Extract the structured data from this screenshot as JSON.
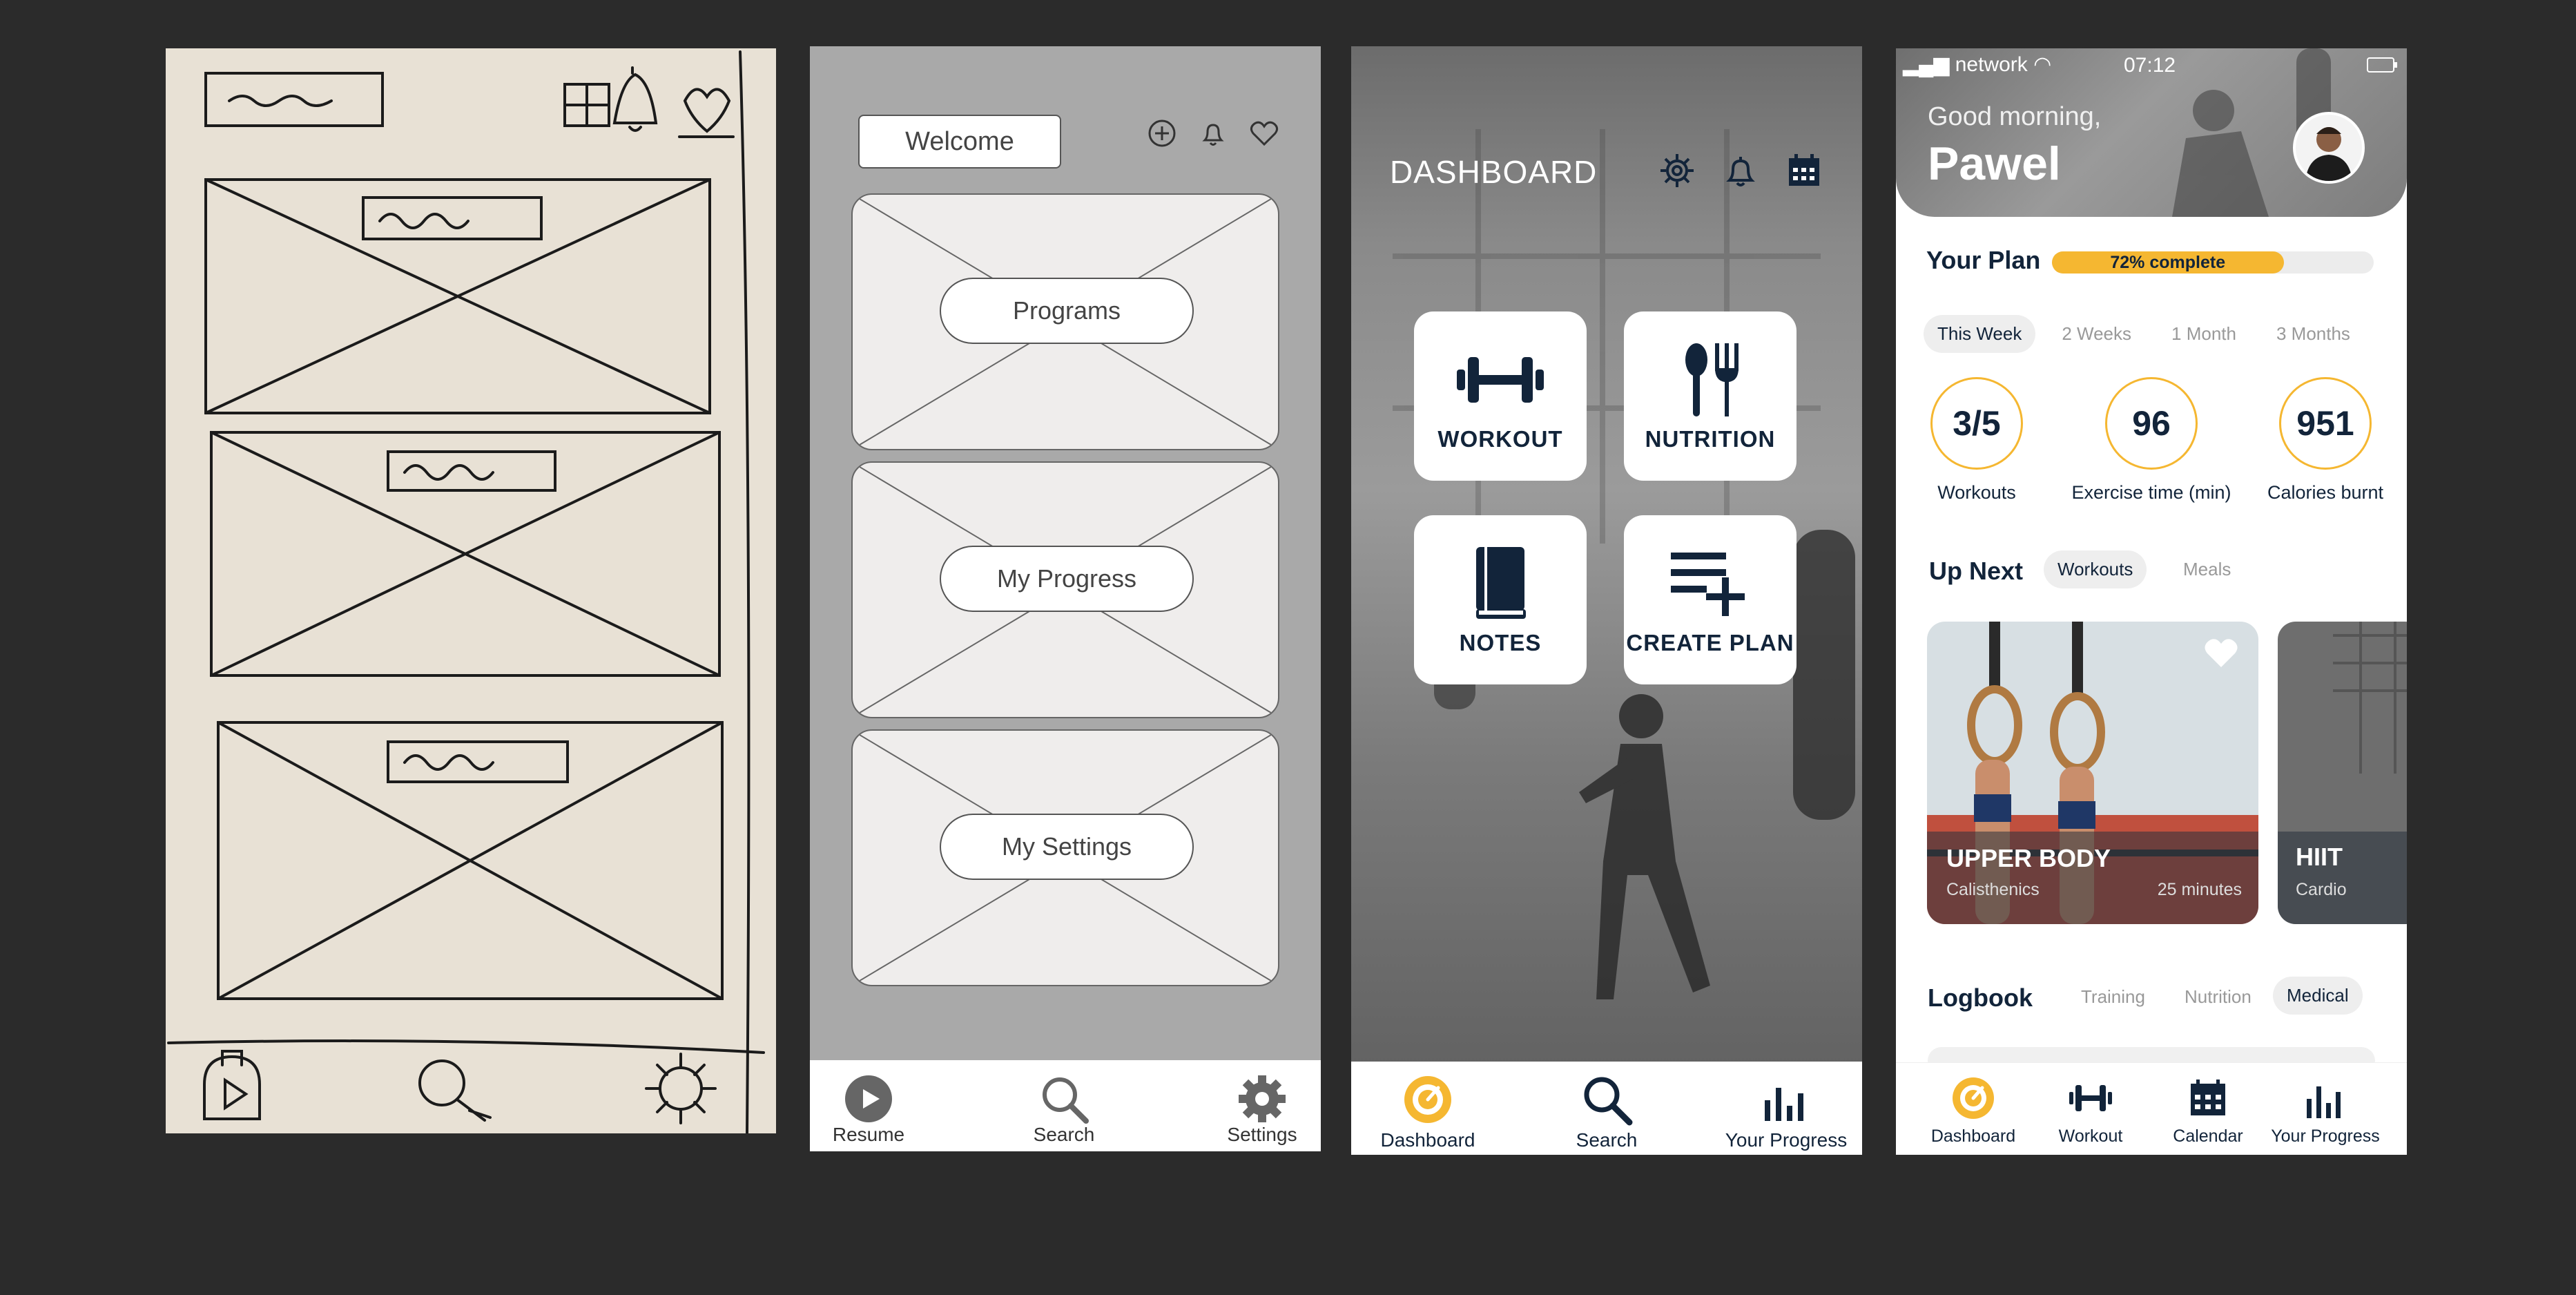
{
  "wireframe": {
    "welcome_label": "Welcome",
    "cards": [
      "Programs",
      "My Progress",
      "My Settings"
    ],
    "nav": [
      {
        "label": "Resume",
        "icon": "play-circle-icon"
      },
      {
        "label": "Search",
        "icon": "search-icon"
      },
      {
        "label": "Settings",
        "icon": "gear-icon"
      }
    ]
  },
  "dashboard": {
    "title": "DASHBOARD",
    "tiles": [
      {
        "label": "WORKOUT",
        "icon": "dumbbell-icon"
      },
      {
        "label": "NUTRITION",
        "icon": "fork-spoon-icon"
      },
      {
        "label": "NOTES",
        "icon": "notebook-icon"
      },
      {
        "label": "CREATE PLAN",
        "icon": "playlist-add-icon"
      }
    ],
    "nav": [
      {
        "label": "Dashboard",
        "icon": "dashboard-icon"
      },
      {
        "label": "Search",
        "icon": "search-icon"
      },
      {
        "label": "Your Progress",
        "icon": "bar-chart-icon"
      }
    ],
    "accent": "#f5b731"
  },
  "app": {
    "status": {
      "network": "network",
      "time": "07:12"
    },
    "greeting": "Good morning,",
    "user_name": "Pawel",
    "plan": {
      "title": "Your Plan",
      "progress_label": "72% complete",
      "progress": 0.72
    },
    "periods": [
      "This Week",
      "2 Weeks",
      "1 Month",
      "3 Months"
    ],
    "stats": [
      {
        "value": "3/5",
        "label": "Workouts"
      },
      {
        "value": "96",
        "label": "Exercise time (min)"
      },
      {
        "value": "951",
        "label": "Calories burnt"
      }
    ],
    "up_next": {
      "title": "Up Next",
      "tabs": [
        "Workouts",
        "Meals"
      ]
    },
    "workouts": [
      {
        "title": "UPPER BODY",
        "category": "Calisthenics",
        "duration": "25 minutes"
      },
      {
        "title": "HIIT",
        "category": "Cardio"
      }
    ],
    "logbook": {
      "title": "Logbook",
      "tabs": [
        "Training",
        "Nutrition",
        "Medical"
      ]
    },
    "nav": [
      {
        "label": "Dashboard",
        "icon": "dashboard-icon"
      },
      {
        "label": "Workout",
        "icon": "dumbbell-icon"
      },
      {
        "label": "Calendar",
        "icon": "calendar-icon"
      },
      {
        "label": "Your Progress",
        "icon": "bar-chart-icon"
      }
    ],
    "colors": {
      "navy": "#12243a",
      "accent": "#f5b731"
    }
  }
}
